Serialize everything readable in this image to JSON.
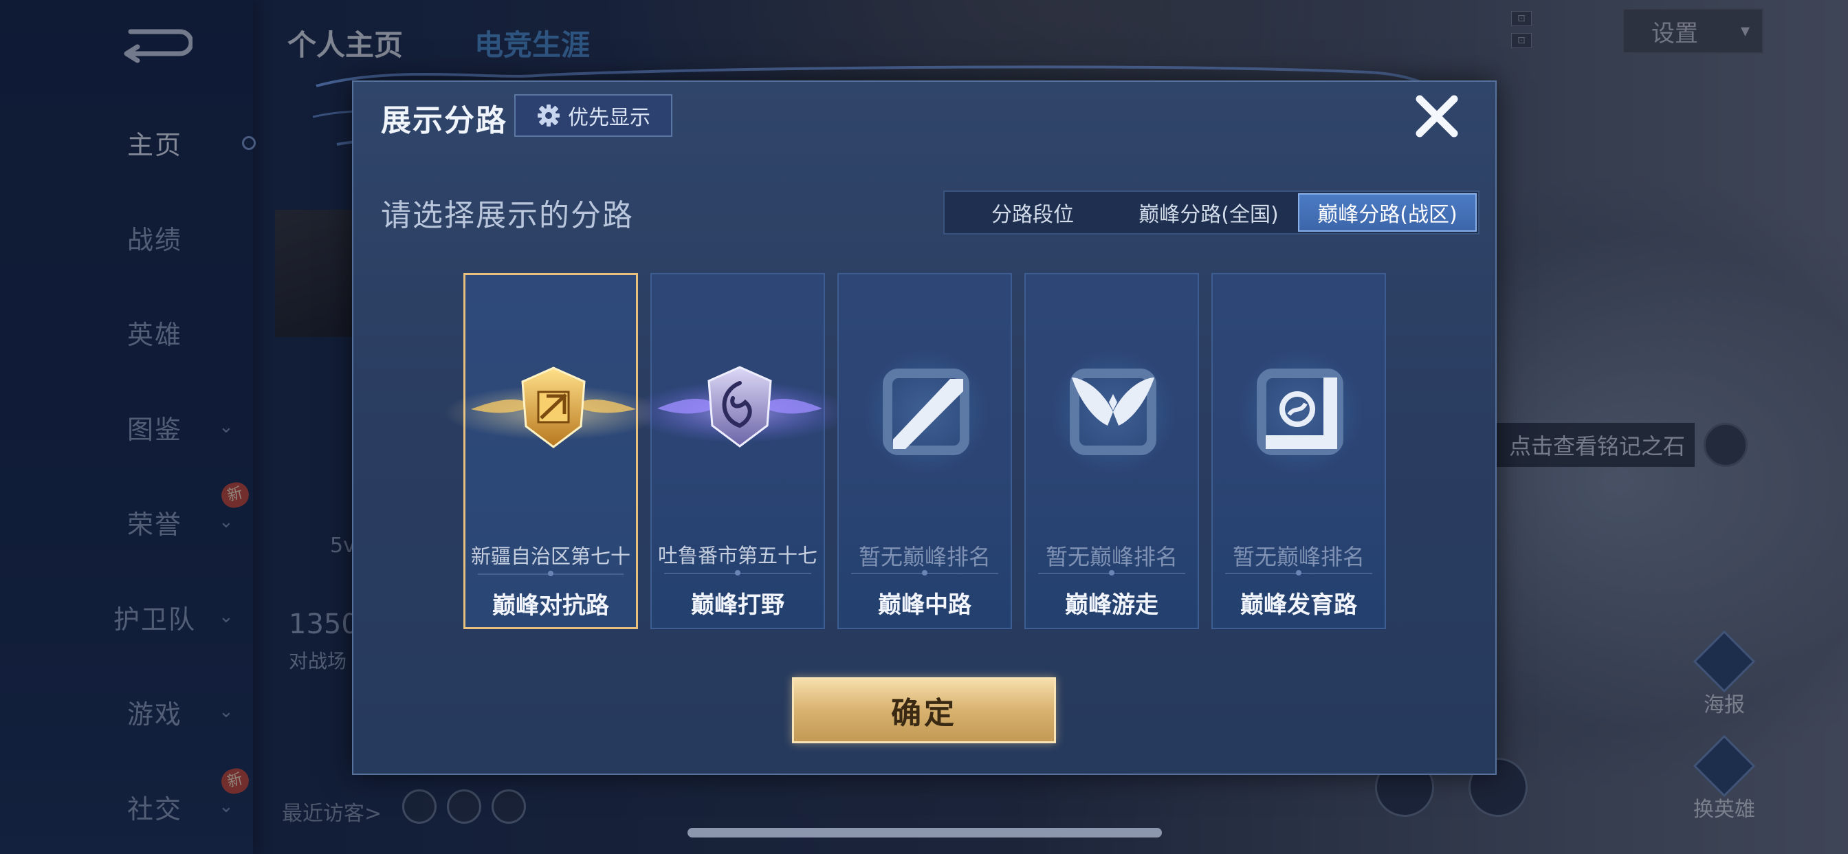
{
  "background": {
    "tabs": [
      "个人主页",
      "电竞生涯"
    ],
    "sidebar": [
      {
        "label": "主页",
        "active": true,
        "chevron": false,
        "badge": ""
      },
      {
        "label": "战绩",
        "active": false,
        "chevron": false,
        "badge": ""
      },
      {
        "label": "英雄",
        "active": false,
        "chevron": false,
        "badge": ""
      },
      {
        "label": "图鉴",
        "active": false,
        "chevron": true,
        "badge": ""
      },
      {
        "label": "荣誉",
        "active": false,
        "chevron": true,
        "badge": "新"
      },
      {
        "label": "护卫队",
        "active": false,
        "chevron": true,
        "badge": ""
      },
      {
        "label": "游戏",
        "active": false,
        "chevron": true,
        "badge": ""
      },
      {
        "label": "社交",
        "active": false,
        "chevron": true,
        "badge": "新"
      }
    ],
    "settings_label": "设置",
    "runestone_hint": "点击查看铭记之石",
    "poster_label": "海报",
    "switch_hero_label": "换英雄",
    "recent_visitors": "最近访客>",
    "stat_value": "1350",
    "stat_label": "对战场",
    "partial_text": "5v"
  },
  "modal": {
    "title": "展示分路",
    "priority_label": "优先显示",
    "subtitle": "请选择展示的分路",
    "filter_tabs": [
      {
        "label": "分路段位",
        "selected": false
      },
      {
        "label": "巅峰分路(全国)",
        "selected": false
      },
      {
        "label": "巅峰分路(战区)",
        "selected": true
      }
    ],
    "lanes": [
      {
        "name": "巅峰对抗路",
        "rank": "新疆自治区第七十",
        "selected": true,
        "icon": "gold-shield-icon"
      },
      {
        "name": "巅峰打野",
        "rank": "吐鲁番市第五十七",
        "selected": false,
        "icon": "purple-dragon-shield-icon"
      },
      {
        "name": "巅峰中路",
        "rank": "暂无巅峰排名",
        "selected": false,
        "icon": "mid-lane-icon"
      },
      {
        "name": "巅峰游走",
        "rank": "暂无巅峰排名",
        "selected": false,
        "icon": "roam-wings-icon"
      },
      {
        "name": "巅峰发育路",
        "rank": "暂无巅峰排名",
        "selected": false,
        "icon": "farm-lane-icon"
      }
    ],
    "confirm_label": "确定"
  },
  "colors": {
    "accent_gold": "#e6c07c",
    "tab_selected": "#4b7bc4",
    "modal_bg": "#2a3d61"
  }
}
